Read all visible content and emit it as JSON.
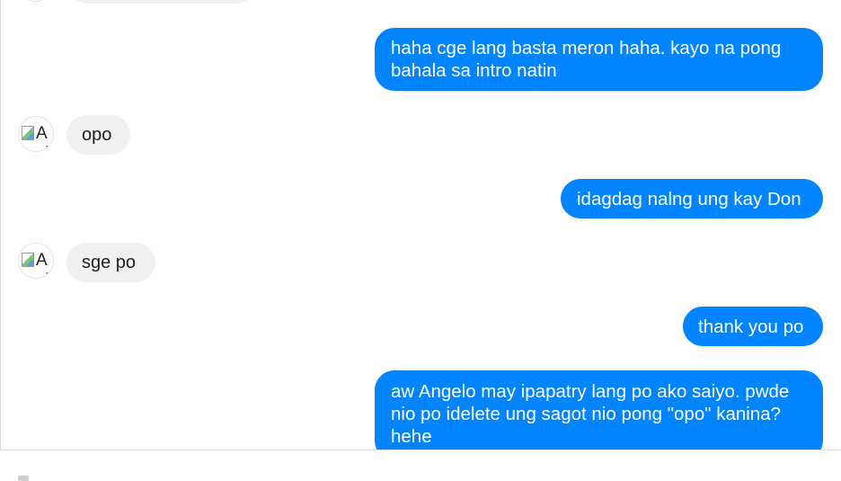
{
  "messages": [
    {
      "side": "out",
      "lines": [
        "haha cge lang basta meron haha. kayo na pong",
        "bahala sa intro natin"
      ]
    },
    {
      "side": "in",
      "text": "opo",
      "avatar_alt": "A"
    },
    {
      "side": "out",
      "text": "idagdag nalng ung kay Don"
    },
    {
      "side": "in",
      "text": "sge po",
      "avatar_alt": "A"
    },
    {
      "side": "out",
      "text": "thank you po"
    },
    {
      "side": "out",
      "lines": [
        "aw Angelo may ipapatry lang po ako saiyo. pwde",
        "nio po idelete ung sagot nio pong \"opo\" kanina?",
        "hehe"
      ]
    }
  ],
  "colors": {
    "outgoing_bubble": "#0084ff",
    "incoming_bubble": "#f0f0f0"
  },
  "icons": {
    "avatar": "broken-image-icon"
  }
}
